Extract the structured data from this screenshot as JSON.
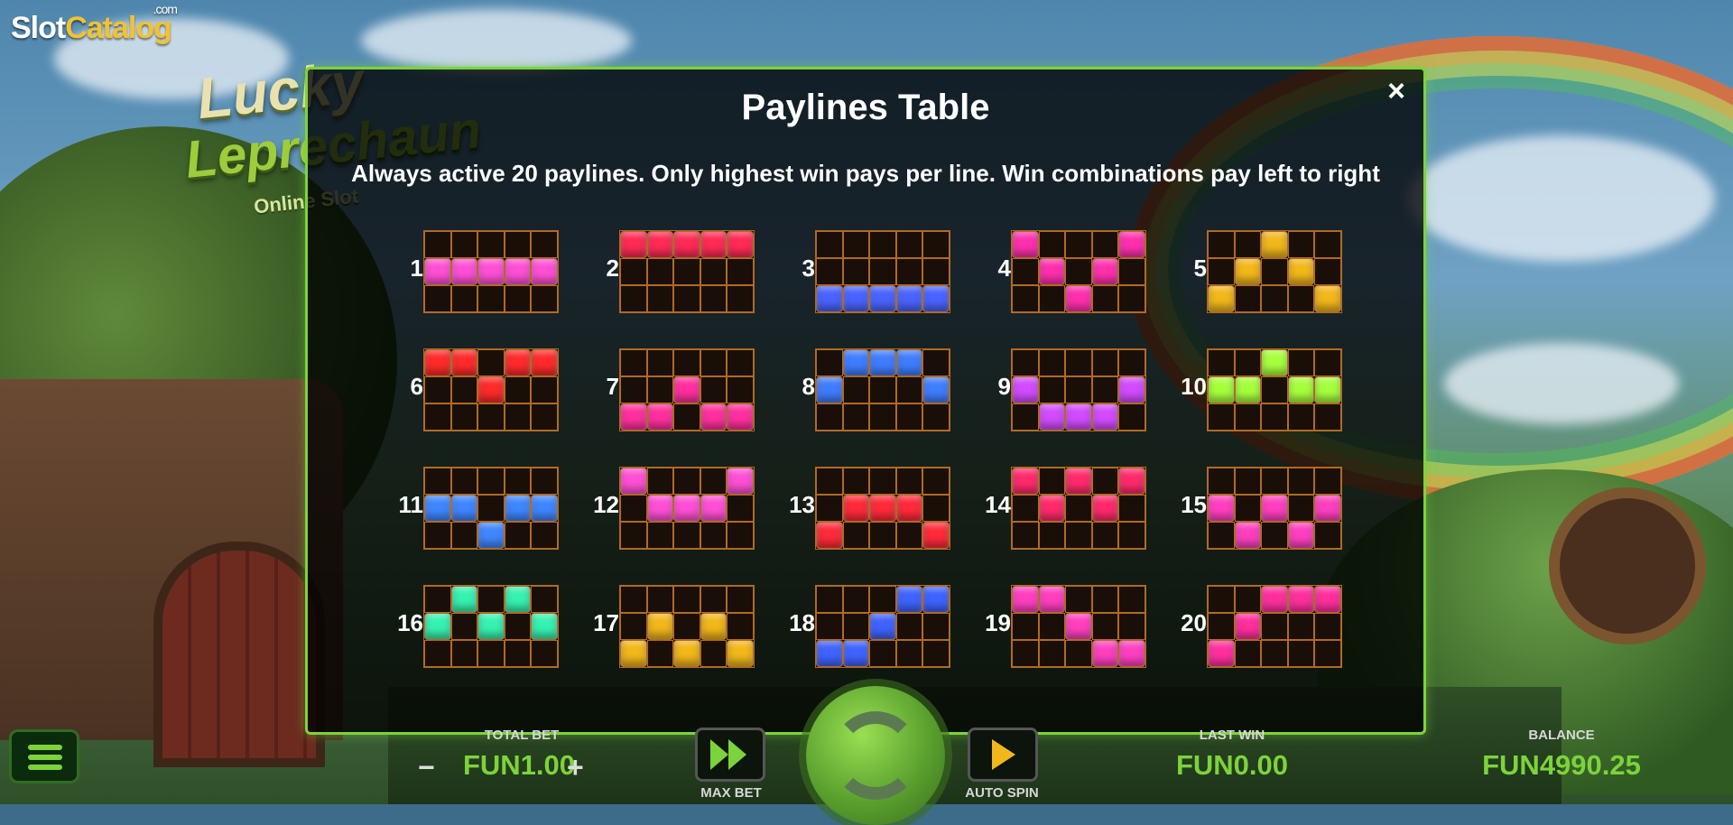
{
  "brand": {
    "name_a": "Slot",
    "name_b": "Catalog",
    "tld": ".com"
  },
  "game_logo": {
    "line1": "Lucky",
    "line2": "Leprechaun",
    "line3": "Online Slot"
  },
  "modal": {
    "title": "Paylines Table",
    "subtitle": "Always active 20 paylines. Only highest win pays per line. Win combinations pay left to right",
    "close_label": "×"
  },
  "paylines": [
    {
      "num": "1",
      "color": "#ff4fd6",
      "rows": [
        1,
        1,
        1,
        1,
        1
      ]
    },
    {
      "num": "2",
      "color": "#ff2a55",
      "rows": [
        0,
        0,
        0,
        0,
        0
      ]
    },
    {
      "num": "3",
      "color": "#4a63ff",
      "rows": [
        2,
        2,
        2,
        2,
        2
      ]
    },
    {
      "num": "4",
      "color": "#ff2fae",
      "rows": [
        0,
        1,
        2,
        1,
        0
      ]
    },
    {
      "num": "5",
      "color": "#f2b71a",
      "rows": [
        2,
        1,
        0,
        1,
        2
      ]
    },
    {
      "num": "6",
      "color": "#ff2a2a",
      "rows": [
        0,
        0,
        1,
        0,
        0
      ]
    },
    {
      "num": "7",
      "color": "#ff2f9e",
      "rows": [
        2,
        2,
        1,
        2,
        2
      ]
    },
    {
      "num": "8",
      "color": "#3f7dff",
      "rows": [
        1,
        0,
        0,
        0,
        1
      ]
    },
    {
      "num": "9",
      "color": "#d24bff",
      "rows": [
        1,
        2,
        2,
        2,
        1
      ]
    },
    {
      "num": "10",
      "color": "#a6ff3c",
      "rows": [
        1,
        1,
        0,
        1,
        1
      ]
    },
    {
      "num": "11",
      "color": "#3f86ff",
      "rows": [
        1,
        1,
        2,
        1,
        1
      ]
    },
    {
      "num": "12",
      "color": "#ff4fd6",
      "rows": [
        0,
        1,
        1,
        1,
        0
      ]
    },
    {
      "num": "13",
      "color": "#ff2a3a",
      "rows": [
        2,
        1,
        1,
        1,
        2
      ]
    },
    {
      "num": "14",
      "color": "#ff2a6b",
      "rows": [
        0,
        1,
        0,
        1,
        0
      ]
    },
    {
      "num": "15",
      "color": "#ff3fc0",
      "rows": [
        1,
        2,
        1,
        2,
        1
      ]
    },
    {
      "num": "16",
      "color": "#36f2b0",
      "rows": [
        1,
        0,
        1,
        0,
        1
      ]
    },
    {
      "num": "17",
      "color": "#f2b71a",
      "rows": [
        2,
        1,
        2,
        1,
        2
      ]
    },
    {
      "num": "18",
      "color": "#3f63ff",
      "rows": [
        2,
        2,
        1,
        0,
        0
      ]
    },
    {
      "num": "19",
      "color": "#ff3fc0",
      "rows": [
        0,
        0,
        1,
        2,
        2
      ]
    },
    {
      "num": "20",
      "color": "#ff2f9e",
      "rows": [
        2,
        1,
        0,
        0,
        0
      ]
    }
  ],
  "footer": {
    "total_bet_label": "TOTAL BET",
    "total_bet_value": "FUN1.00",
    "minus": "−",
    "plus": "+",
    "max_bet_label": "MAX BET",
    "auto_spin_label": "AUTO SPIN",
    "last_win_label": "LAST WIN",
    "last_win_value": "FUN0.00",
    "balance_label": "BALANCE",
    "balance_value": "FUN4990.25"
  },
  "colors": {
    "accent": "#7cd33b",
    "grid_line": "#b06a24"
  }
}
